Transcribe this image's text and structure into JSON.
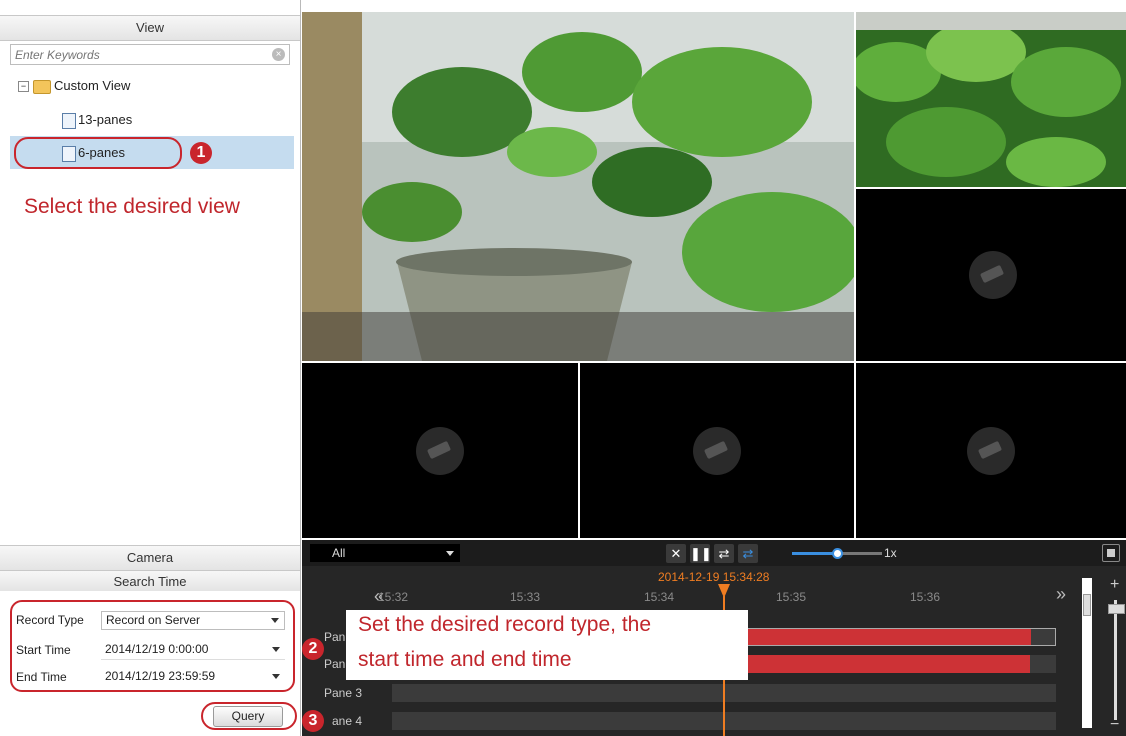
{
  "view_panel": {
    "title": "View",
    "search_placeholder": "Enter Keywords",
    "tree": {
      "root_label": "Custom View",
      "items": [
        {
          "label": "13-panes"
        },
        {
          "label": "6-panes",
          "selected": true
        }
      ]
    }
  },
  "camera_panel": {
    "title": "Camera"
  },
  "search_time": {
    "title": "Search Time",
    "record_type_label": "Record Type",
    "record_type_value": "Record on Server",
    "start_time_label": "Start Time",
    "start_time_value": "2014/12/19 0:00:00",
    "end_time_label": "End Time",
    "end_time_value": "2014/12/19 23:59:59",
    "query_label": "Query"
  },
  "playback": {
    "filter_value": "All",
    "speed_label": "1x",
    "speed_level": 0.5,
    "current_time": "2014-12-19 15:34:28",
    "ticks": [
      "15:32",
      "15:33",
      "15:34",
      "15:35",
      "15:36"
    ],
    "panes": [
      {
        "label": "Pane 1",
        "visible": "Pan"
      },
      {
        "label": "Pane 2",
        "visible": "Pan"
      },
      {
        "label": "Pane 3",
        "visible": "Pane 3"
      },
      {
        "label": "Pane 4",
        "visible": "ane 4"
      }
    ],
    "nav_left": "«",
    "nav_right": "»"
  },
  "annotations": {
    "step1": "1",
    "step2": "2",
    "step3": "3",
    "step1_text": "Select  the desired view",
    "step2_line1": "Set the desired record type, the",
    "step2_line2": "start time and end time"
  },
  "colors": {
    "annotation_red": "#c9252c",
    "record_bar": "#cd3236",
    "current_time": "#ef7d22",
    "speed_slider": "#3a8fe0"
  }
}
